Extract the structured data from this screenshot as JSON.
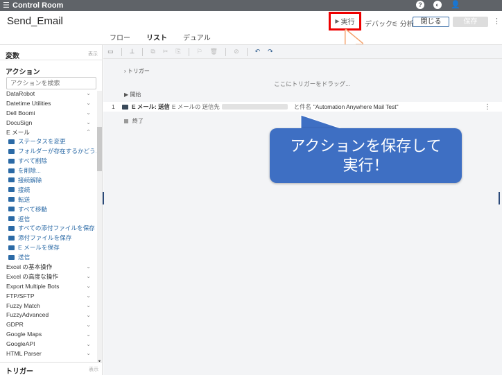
{
  "topbar": {
    "menu_icon": "hamburger-icon",
    "title": "Control Room"
  },
  "header": {
    "bot_name": "Send_Email",
    "run_label": "実行",
    "debug_label": "デバック",
    "analyze_label": "分析",
    "close_label": "閉じる",
    "save_label": "保存"
  },
  "tabs": [
    {
      "label": "フロー"
    },
    {
      "label": "リスト"
    },
    {
      "label": "デュアル"
    }
  ],
  "left": {
    "variables_title": "変数",
    "variables_toggle": "表示",
    "actions_title": "アクション",
    "search_placeholder": "アクションを検索",
    "packages_before": [
      "DataRobot",
      "Datetime Utilities",
      "Dell Boomi",
      "DocuSign"
    ],
    "email_package": "E メール",
    "email_actions": [
      "ステータスを変更",
      "フォルダーが存在するかどう...",
      "すべて削除",
      "を削除...",
      "接続解除",
      "接続",
      "転送",
      "すべて移動",
      "返信",
      "すべての添付ファイルを保存",
      "添付ファイルを保存",
      "E メールを保存",
      "送信"
    ],
    "packages_after": [
      "Excel の基本操作",
      "Excel の高度な操作",
      "Export Multiple Bots",
      "FTP/SFTP",
      "Fuzzy Match",
      "FuzzyAdvanced",
      "GDPR",
      "Google Maps",
      "GoogleAPI",
      "HTML Parser"
    ],
    "triggers_title": "トリガー",
    "triggers_toggle": "表示"
  },
  "canvas": {
    "trigger_label": "トリガー",
    "drop_hint": "ここにトリガーをドラッグ...",
    "start_label": "開始",
    "line_number": "1",
    "action_name": "E メール: 送信",
    "action_desc": "E メールの 送信先",
    "action_subject_prefix": "と件名",
    "action_subject": "\"Automation Anywhere Mail Test\"",
    "end_label": "終了"
  },
  "callout": {
    "line1": "アクションを保存して",
    "line2": "実行！"
  },
  "colors": {
    "topbar": "#5f6368",
    "highlight": "#ee0000",
    "callout": "#3e6fc3",
    "cursor": "#f4a26b",
    "link": "#2b6aa6"
  }
}
